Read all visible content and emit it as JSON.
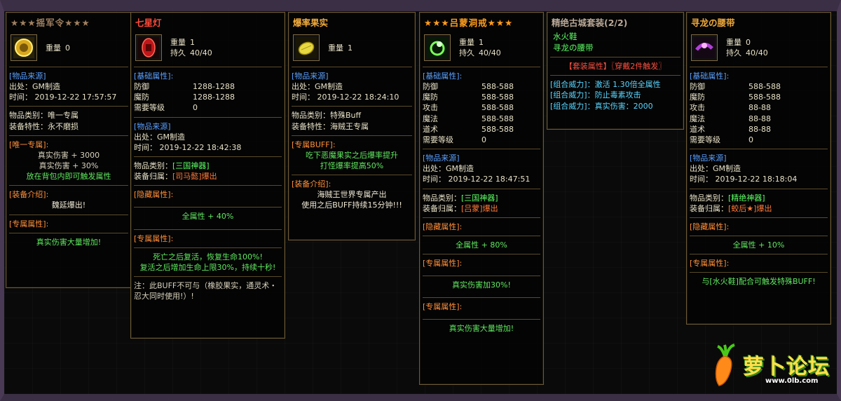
{
  "p1": {
    "title": "★★★摇军令★★★",
    "weight_label": "重量",
    "weight": "0",
    "src_label": "[物品来源]",
    "src_from": "出处：GM制造",
    "src_time": "时间： 2019-12-22 17:57:57",
    "cat": "物品类别：唯一专属",
    "feat": "装备特性：永不磨损",
    "uniq_label": "[唯一专属]:",
    "uniq1": "真实伤害 + 3000",
    "uniq2": "真实伤害 + 30%",
    "uniq3": "放在背包内即可触发属性",
    "intro_label": "[装备介绍]:",
    "intro": "魏延爆出!",
    "ex_label": "[专属属性]:",
    "ex": "真实伤害大量增加!"
  },
  "p2": {
    "title": "七星灯",
    "weight_label": "重量",
    "weight": "1",
    "dur_label": "持久",
    "dur": "40/40",
    "base_label": "[基础属性]:",
    "stats": [
      {
        "k": "防御",
        "v": "1288-1288"
      },
      {
        "k": "魔防",
        "v": "1288-1288"
      },
      {
        "k": "需要等级",
        "v": "0"
      }
    ],
    "src_label": "[物品来源]",
    "src_from": "出处：GM制造",
    "src_time": "时间： 2019-12-22 18:42:38",
    "cat_k": "物品类别：",
    "cat_v": "[三国神器]",
    "own_k": "装备归属：",
    "own_v": "[司马懿]爆出",
    "hidden_label": "[隐藏属性]:",
    "hidden": "全属性 + 40%",
    "ex_label": "[专属属性]:",
    "ex1": "死亡之后复活，恢复生命100%!",
    "ex2": "复活之后增加生命上限30%，持续十秒!",
    "note1": "注：此BUFF不可与（橡胶果实，通灵术・",
    "note2": "忍大同时使用!）!"
  },
  "p3": {
    "title": "爆率果实",
    "weight_label": "重量",
    "weight": "1",
    "src_label": "[物品来源]",
    "src_from": "出处：GM制造",
    "src_time": "时间： 2019-12-22 18:24:10",
    "cat": "物品类别：特殊Buff",
    "feat": "装备特性：海贼王专属",
    "buff_label": "[专属BUFF]:",
    "buff1": "吃下恶魔果实之后爆率提升",
    "buff2": "打怪爆率提高50%",
    "intro_label": "[装备介绍]:",
    "intro1": "海贼王世界专属产出",
    "intro2": "使用之后BUFF持续15分钟!!!"
  },
  "p4": {
    "title": "★★★吕蒙洞戒★★★",
    "weight_label": "重量",
    "weight": "1",
    "dur_label": "持久",
    "dur": "40/40",
    "base_label": "[基础属性]:",
    "stats": [
      {
        "k": "防御",
        "v": "588-588"
      },
      {
        "k": "魔防",
        "v": "588-588"
      },
      {
        "k": "攻击",
        "v": "588-588"
      },
      {
        "k": "魔法",
        "v": "588-588"
      },
      {
        "k": "道术",
        "v": "588-588"
      },
      {
        "k": "需要等级",
        "v": "0"
      }
    ],
    "src_label": "[物品来源]",
    "src_from": "出处：GM制造",
    "src_time": "时间： 2019-12-22 18:47:51",
    "cat_k": "物品类别：",
    "cat_v": "[三国神器]",
    "own_k": "装备归属：",
    "own_v": "[吕蒙]爆出",
    "hidden_label": "[隐藏属性]:",
    "hidden": "全属性 + 80%",
    "ex_label": "[专属属性]:",
    "ex": "真实伤害加30%!",
    "ex2_label": "[专属属性]:",
    "ex2": "真实伤害大量增加!"
  },
  "p5": {
    "title": "精绝古城套装(2/2)",
    "item1": "水火鞋",
    "item2": "寻龙の腰带",
    "set_label": "【套装属性】〖穿戴2件触发〗",
    "c1_k": "[组合威力]：",
    "c1_v": "激活 1.30倍全属性",
    "c2_k": "[组合威力]：",
    "c2_v": "防止毒素攻击",
    "c3_k": "[组合威力]：",
    "c3_v": "真实伤害：2000"
  },
  "p6": {
    "title": "寻龙の腰带",
    "weight_label": "重量",
    "weight": "0",
    "dur_label": "持久",
    "dur": "40/40",
    "base_label": "[基础属性]:",
    "stats": [
      {
        "k": "防御",
        "v": "588-588"
      },
      {
        "k": "魔防",
        "v": "588-588"
      },
      {
        "k": "攻击",
        "v": "88-88"
      },
      {
        "k": "魔法",
        "v": "88-88"
      },
      {
        "k": "道术",
        "v": "88-88"
      },
      {
        "k": "需要等级",
        "v": "0"
      }
    ],
    "src_label": "[物品来源]",
    "src_from": "出处：GM制造",
    "src_time": "时间： 2019-12-22 18:18:04",
    "cat_k": "物品类别：",
    "cat_v": "[精绝神器]",
    "own_k": "装备归属：",
    "own_v": "[蛟后★]爆出",
    "hidden_label": "[隐藏属性]:",
    "hidden": "全属性 + 10%",
    "ex_label": "[专属属性]:",
    "ex": "与[水火鞋]配合可触发特殊BUFF!"
  },
  "logo": {
    "text": "萝卜论坛",
    "url": "www.0lb.com"
  },
  "colors": {
    "frame": "#3a2f44",
    "panel_border": "#6b5a36",
    "label_blue": "#5aa0ff",
    "green": "#5cff64",
    "orange": "#ff7a38"
  },
  "icons": [
    "token-icon",
    "red-lamp-icon",
    "yellow-fruit-icon",
    "green-ring-icon",
    "purple-belt-icon"
  ]
}
